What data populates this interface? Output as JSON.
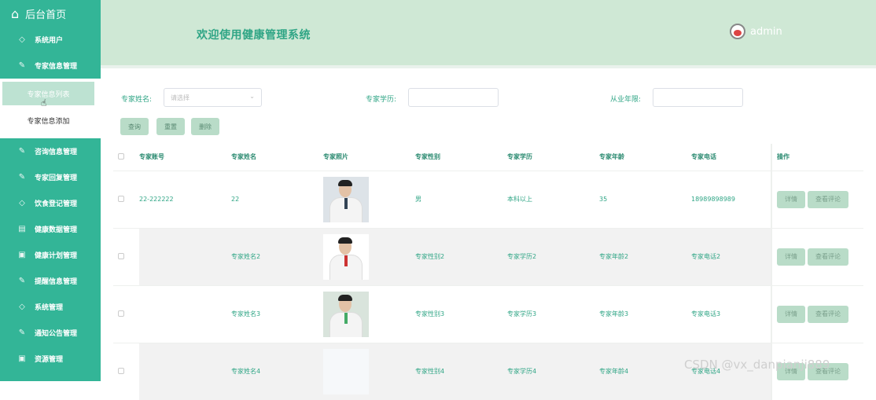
{
  "sidebar": {
    "home_label": "后台首页",
    "items_top": [
      {
        "label": "系统用户",
        "icon": "diamond-icon"
      },
      {
        "label": "专家信息管理",
        "icon": "edit-icon"
      }
    ],
    "sub_items": [
      {
        "label": "专家信息列表",
        "active": true
      },
      {
        "label": "专家信息添加",
        "active": false
      }
    ],
    "items_bottom": [
      {
        "label": "咨询信息管理",
        "icon": "edit-icon"
      },
      {
        "label": "专家回复管理",
        "icon": "edit-icon"
      },
      {
        "label": "饮食登记管理",
        "icon": "diamond-icon"
      },
      {
        "label": "健康数据管理",
        "icon": "chart-icon"
      },
      {
        "label": "健康计划管理",
        "icon": "doc-icon"
      },
      {
        "label": "提醒信息管理",
        "icon": "edit-icon"
      },
      {
        "label": "系统管理",
        "icon": "diamond-icon"
      },
      {
        "label": "通知公告管理",
        "icon": "edit-icon"
      },
      {
        "label": "资源管理",
        "icon": "doc-icon"
      }
    ]
  },
  "header": {
    "title": "欢迎使用健康管理系统",
    "user": "admin"
  },
  "search": {
    "name_label": "专家姓名:",
    "name_placeholder": "请选择",
    "edu_label": "专家学历:",
    "years_label": "从业年限:"
  },
  "actions": {
    "query": "查询",
    "reset": "重置",
    "delete": "删除"
  },
  "table": {
    "columns": [
      "专家账号",
      "专家姓名",
      "专家照片",
      "专家性别",
      "专家学历",
      "专家年龄",
      "专家电话",
      "操作"
    ],
    "rows": [
      {
        "account": "22-222222",
        "name": "22",
        "gender": "男",
        "edu": "本科以上",
        "age": "35",
        "phone": "18989898989"
      },
      {
        "account": "",
        "name": "专家姓名2",
        "gender": "专家性别2",
        "edu": "专家学历2",
        "age": "专家年龄2",
        "phone": "专家电话2"
      },
      {
        "account": "",
        "name": "专家姓名3",
        "gender": "专家性别3",
        "edu": "专家学历3",
        "age": "专家年龄3",
        "phone": "专家电话3"
      },
      {
        "account": "",
        "name": "专家姓名4",
        "gender": "专家性别4",
        "edu": "专家学历4",
        "age": "专家年龄4",
        "phone": "专家电话4"
      }
    ],
    "detail_label": "详情",
    "comment_label": "查看评论"
  },
  "watermark": "CSDN @vx_danpianji889",
  "colors": {
    "sidebar": "#33b597",
    "header": "#cfe8d5",
    "accent": "#2fa585"
  }
}
